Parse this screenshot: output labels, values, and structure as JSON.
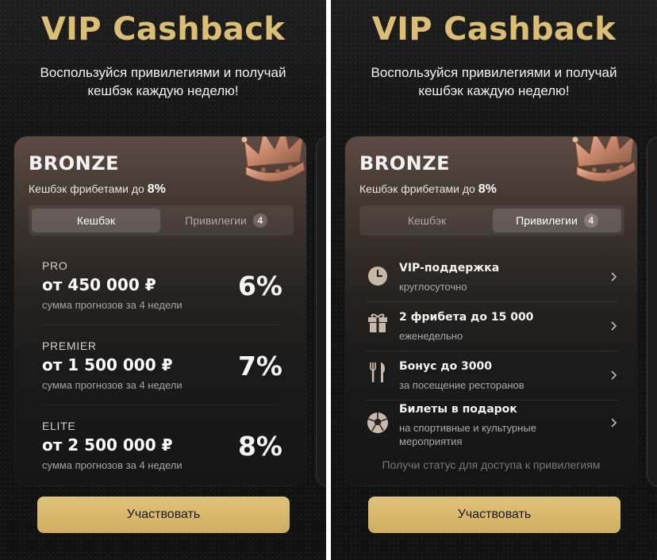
{
  "header": {
    "title": "VIP Cashback",
    "subtitle_line1": "Воспользуйся привилегиями и получай",
    "subtitle_line2": "кешбэк каждую неделю!"
  },
  "card": {
    "tier_name": "BRONZE",
    "tier_subtitle": "Кешбэк фрибетами до",
    "tier_percent": "8%"
  },
  "tabs": {
    "cashback": "Кешбэк",
    "privileges": "Привилегии",
    "privileges_count": "4"
  },
  "levels": [
    {
      "name": "PRO",
      "amount": "от 450 000 ₽",
      "note": "сумма прогнозов за 4 недели",
      "percent": "6%"
    },
    {
      "name": "PREMIER",
      "amount": "от 1 500 000 ₽",
      "note": "сумма прогнозов за 4 недели",
      "percent": "7%"
    },
    {
      "name": "ELITE",
      "amount": "от 2 500 000 ₽",
      "note": "сумма прогнозов за 4 недели",
      "percent": "8%"
    }
  ],
  "privileges": [
    {
      "title": "VIP-поддержка",
      "subtitle": "круглосуточно",
      "icon": "clock-icon"
    },
    {
      "title": "2 фрибета до 15 000",
      "subtitle": "еженедельно",
      "icon": "gift-icon"
    },
    {
      "title": "Бонус до 3000",
      "subtitle": "за посещение ресторанов",
      "icon": "fork-knife-icon"
    },
    {
      "title": "Билеты в подарок",
      "subtitle": "на спортивные и культурные мероприятия",
      "icon": "soccer-ball-icon"
    }
  ],
  "privileges_note": "Получи статус для доступа к привилегиям",
  "cta_label": "Участвовать",
  "colors": {
    "gold": "#dcbd74",
    "button": "#d6b56a",
    "background": "#141414"
  }
}
